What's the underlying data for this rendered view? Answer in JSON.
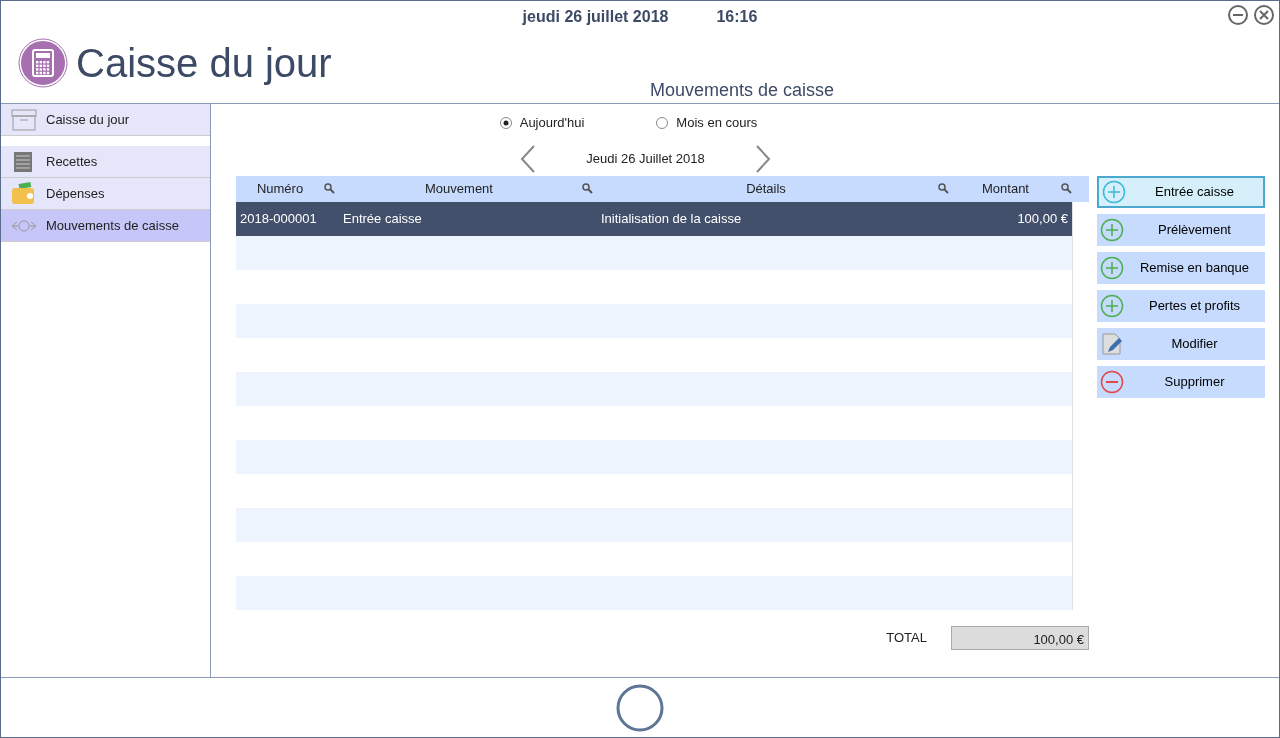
{
  "header": {
    "date": "jeudi 26 juillet 2018",
    "time": "16:16",
    "title": "Caisse du jour",
    "subtitle": "Mouvements de caisse"
  },
  "sidebar": {
    "items": [
      {
        "label": "Caisse du jour",
        "kind": "box",
        "selected": false
      },
      {
        "label": "Recettes",
        "kind": "receipt",
        "selected": false
      },
      {
        "label": "Dépenses",
        "kind": "wallet",
        "selected": false
      },
      {
        "label": "Mouvements de caisse",
        "kind": "arrows",
        "selected": true
      }
    ]
  },
  "period": {
    "options": [
      {
        "label": "Aujourd'hui",
        "selected": true
      },
      {
        "label": "Mois en cours",
        "selected": false
      }
    ],
    "date": "Jeudi 26 Juillet 2018"
  },
  "table": {
    "columns": [
      "Numéro",
      "Mouvement",
      "Détails",
      "Montant"
    ],
    "rows": [
      {
        "cells": [
          "2018-000001",
          "Entrée caisse",
          "Initialisation de la caisse",
          "100,00 €"
        ],
        "selected": true
      }
    ]
  },
  "actions": [
    {
      "label": "Entrée caisse",
      "kind": "add",
      "selected": true
    },
    {
      "label": "Prélèvement",
      "kind": "add",
      "selected": false
    },
    {
      "label": "Remise en banque",
      "kind": "add",
      "selected": false
    },
    {
      "label": "Pertes et profits",
      "kind": "add",
      "selected": false
    },
    {
      "label": "Modifier",
      "kind": "edit",
      "selected": false
    },
    {
      "label": "Supprimer",
      "kind": "remove",
      "selected": false
    }
  ],
  "total": {
    "label": "TOTAL",
    "value": "100,00 €"
  }
}
